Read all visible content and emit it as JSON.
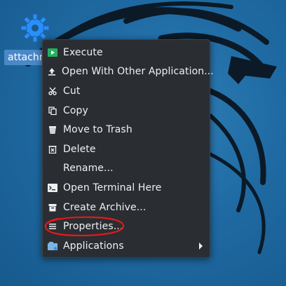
{
  "desktop": {
    "icon": {
      "name": "gear-icon",
      "label": "attachm"
    }
  },
  "menu": {
    "items": [
      {
        "label": "Execute",
        "icon": "play-icon"
      },
      {
        "label": "Open With Other Application...",
        "icon": "upload-icon"
      },
      {
        "label": "Cut",
        "icon": "scissors-icon"
      },
      {
        "label": "Copy",
        "icon": "copy-icon"
      },
      {
        "label": "Move to Trash",
        "icon": "trash-icon"
      },
      {
        "label": "Delete",
        "icon": "delete-icon"
      },
      {
        "label": "Rename...",
        "icon": ""
      },
      {
        "label": "Open Terminal Here",
        "icon": "terminal-icon"
      },
      {
        "label": "Create Archive...",
        "icon": "archive-icon"
      },
      {
        "label": "Properties...",
        "icon": "properties-icon",
        "annotated": true
      },
      {
        "label": "Applications",
        "icon": "applications-icon",
        "submenu": true
      }
    ]
  },
  "colors": {
    "wallpaper": "#1f6aa3",
    "menu_bg": "#2a2e32",
    "menu_text": "#eff0f1",
    "selection_label": "#4a88c7",
    "annotation": "#e3191c"
  }
}
